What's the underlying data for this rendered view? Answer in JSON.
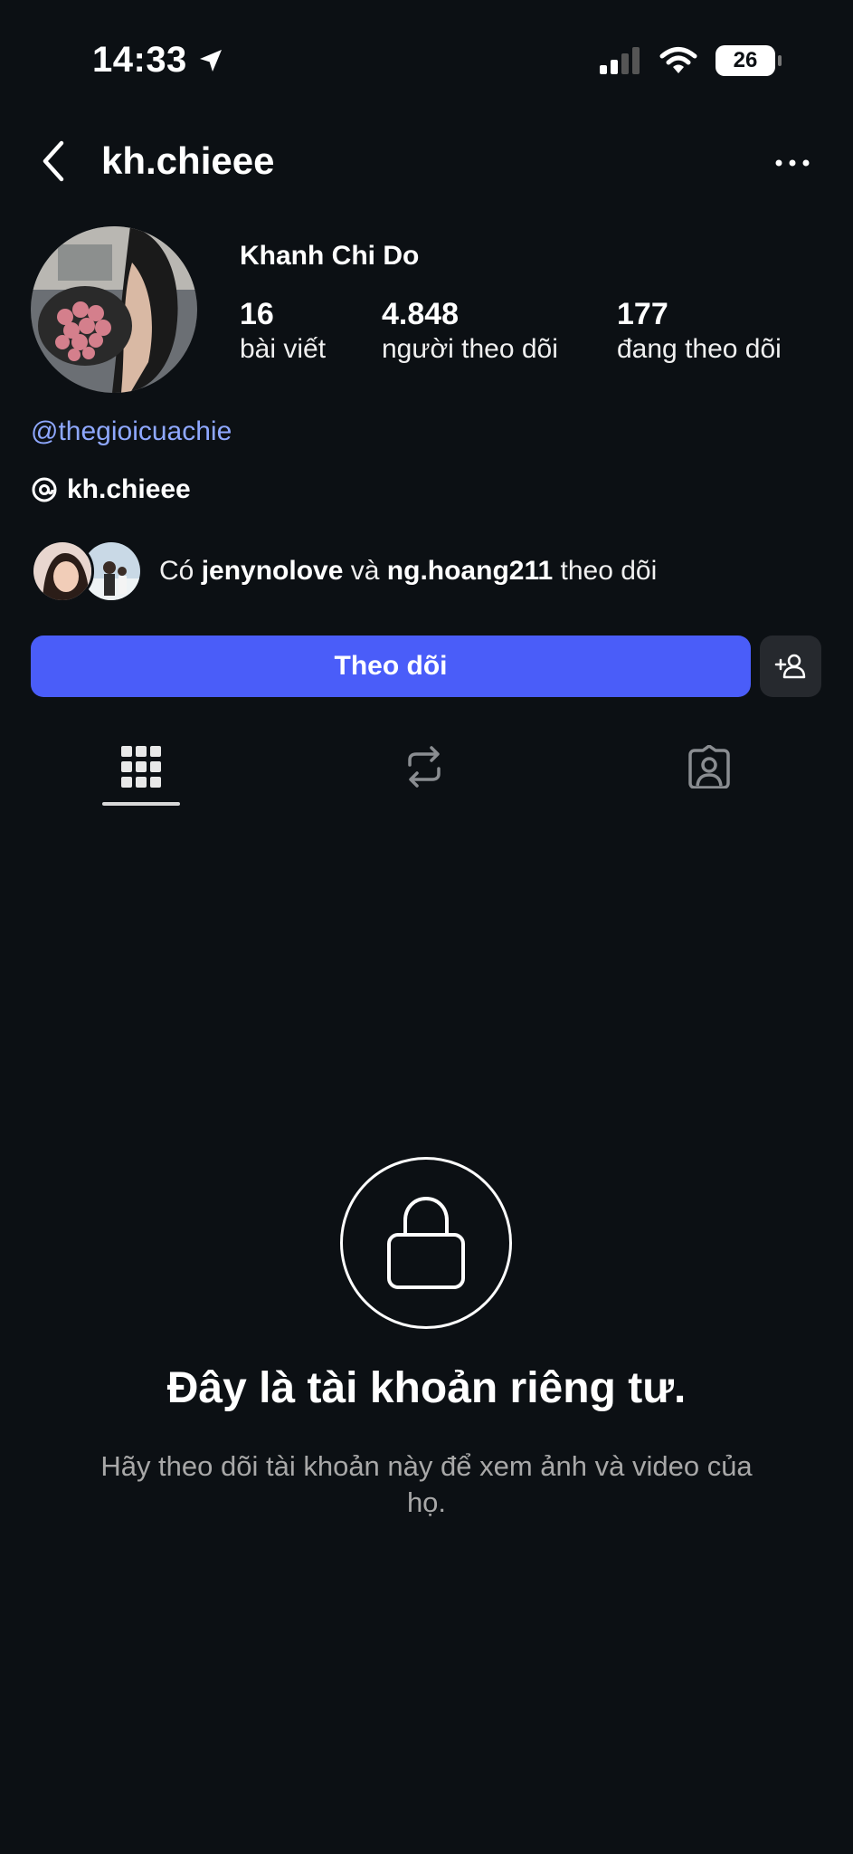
{
  "status_bar": {
    "time": "14:33",
    "battery": "26",
    "icons": [
      "location-arrow-icon",
      "cellular-signal-icon",
      "wifi-icon",
      "battery-icon"
    ]
  },
  "header": {
    "username": "kh.chieee",
    "back_icon": "chevron-left-icon",
    "more_icon": "more-horizontal-icon"
  },
  "profile": {
    "display_name": "Khanh Chi Do",
    "stats": {
      "posts": {
        "value": "16",
        "label": "bài viết"
      },
      "followers": {
        "value": "4.848",
        "label": "người theo dõi"
      },
      "following": {
        "value": "177",
        "label": "đang theo dõi"
      }
    },
    "link": "@thegioicuachie",
    "threads_handle": "kh.chieee"
  },
  "mutual": {
    "prefix": "Có",
    "user1": "jenynolove",
    "conjunction": "và",
    "user2": "ng.hoang211",
    "suffix": "theo dõi"
  },
  "actions": {
    "follow_label": "Theo dõi",
    "suggest_icon": "add-person-icon"
  },
  "tabs": [
    {
      "name": "grid",
      "icon": "grid-icon",
      "active": true
    },
    {
      "name": "reposts",
      "icon": "repost-icon",
      "active": false
    },
    {
      "name": "tagged",
      "icon": "tagged-person-icon",
      "active": false
    }
  ],
  "private_account": {
    "title": "Đây là tài khoản riêng tư.",
    "description": "Hãy theo dõi tài khoản này để xem ảnh và video của họ."
  },
  "colors": {
    "background": "#0c1014",
    "accent": "#4a5df9",
    "link": "#8fa8ff",
    "secondary_text": "#a8a8a8"
  }
}
